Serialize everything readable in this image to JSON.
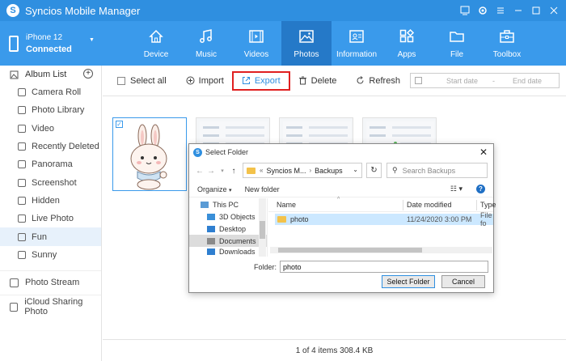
{
  "app": {
    "title": "Syncios Mobile Manager",
    "logo_letter": "S"
  },
  "window_controls": [
    "feedback-icon",
    "settings-icon",
    "menu-icon",
    "minimize-icon",
    "maximize-icon",
    "close-icon"
  ],
  "device": {
    "name": "iPhone 12",
    "status": "Connected"
  },
  "nav": [
    {
      "label": "Device",
      "icon": "home-icon"
    },
    {
      "label": "Music",
      "icon": "music-icon"
    },
    {
      "label": "Videos",
      "icon": "film-icon"
    },
    {
      "label": "Photos",
      "icon": "image-icon",
      "active": true
    },
    {
      "label": "Information",
      "icon": "contact-card-icon"
    },
    {
      "label": "Apps",
      "icon": "apps-icon"
    },
    {
      "label": "File",
      "icon": "folder-icon"
    },
    {
      "label": "Toolbox",
      "icon": "toolbox-icon"
    }
  ],
  "sidebar": {
    "header": "Album List",
    "items": [
      {
        "label": "Camera Roll"
      },
      {
        "label": "Photo Library"
      },
      {
        "label": "Video"
      },
      {
        "label": "Recently Deleted"
      },
      {
        "label": "Panorama"
      },
      {
        "label": "Screenshot"
      },
      {
        "label": "Hidden"
      },
      {
        "label": "Live Photo"
      },
      {
        "label": "Fun",
        "active": true
      },
      {
        "label": "Sunny"
      }
    ],
    "sections": [
      {
        "label": "Photo Stream"
      },
      {
        "label": "iCloud Sharing Photo"
      }
    ]
  },
  "toolbar": {
    "select_all": "Select all",
    "import": "Import",
    "export": "Export",
    "delete": "Delete",
    "refresh": "Refresh",
    "start_date": "Start date",
    "date_sep": "-",
    "end_date": "End date"
  },
  "status": {
    "text": "1 of 4 items 308.4 KB"
  },
  "dialog": {
    "title": "Select Folder",
    "breadcrumb": [
      "Syncios M...",
      "Backups"
    ],
    "search_placeholder": "Search Backups",
    "organize": "Organize",
    "new_folder": "New folder",
    "tree": [
      {
        "label": "This PC",
        "color": "#5a9bd5"
      },
      {
        "label": "3D Objects",
        "color": "#3a8fd8"
      },
      {
        "label": "Desktop",
        "color": "#2f7fd0"
      },
      {
        "label": "Documents",
        "color": "#8a8a8a",
        "active": true
      },
      {
        "label": "Downloads",
        "color": "#2f7fd0"
      }
    ],
    "columns": {
      "name": "Name",
      "date": "Date modified",
      "type": "Type"
    },
    "rows": [
      {
        "name": "photo",
        "date": "11/24/2020 3:00 PM",
        "type": "File fo"
      }
    ],
    "folder_label": "Folder:",
    "folder_value": "photo",
    "select_button": "Select Folder",
    "cancel_button": "Cancel"
  },
  "colors": {
    "accent": "#2f8fe0",
    "nav_bg": "#3a9aeb",
    "nav_active": "#2579c8",
    "highlight": "#e02020"
  }
}
